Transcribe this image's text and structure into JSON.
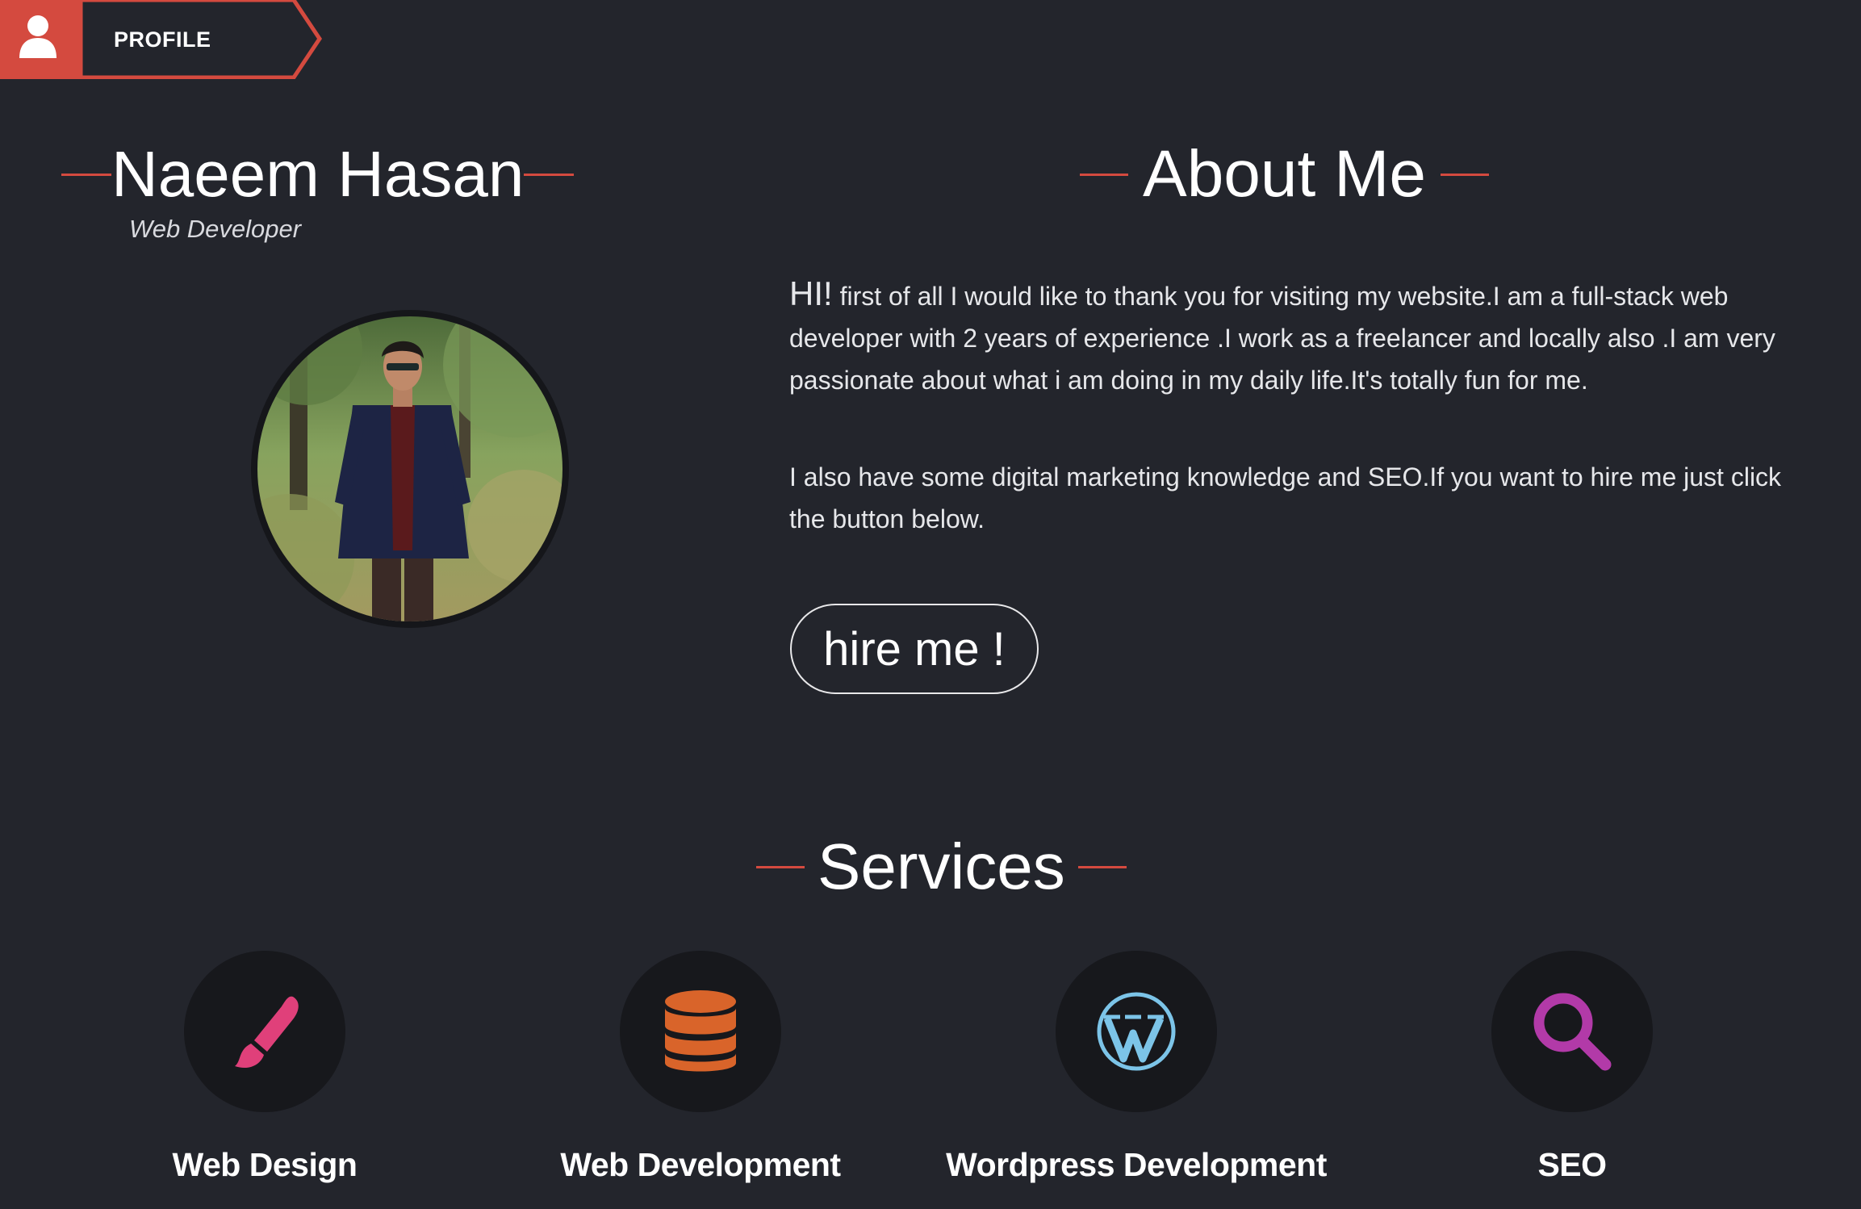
{
  "profile_tab": {
    "label": "PROFILE",
    "icon": "user-icon",
    "accent_color": "#d44a3f"
  },
  "profile": {
    "name": "Naeem Hasan",
    "title": "Web Developer",
    "avatar_alt": "profile-photo"
  },
  "about": {
    "heading": "About Me",
    "greeting": "HI!",
    "paragraph_1": "first of all I would like to thank you for visiting my website.I am a full-stack web developer with 2 years of experience .I work as a freelancer and locally also .I am very passionate about what i am doing in my daily life.It's totally fun for me.",
    "paragraph_2": "I also have some digital marketing knowledge and SEO.If you want to hire me just click the button below.",
    "button_label": "hire me !"
  },
  "services": {
    "heading": "Services",
    "items": [
      {
        "label": "Web Design",
        "icon": "paintbrush-icon",
        "color": "#e0407a"
      },
      {
        "label": "Web Development",
        "icon": "database-icon",
        "color": "#d9642a"
      },
      {
        "label": "Wordpress Development",
        "icon": "wordpress-icon",
        "color": "#7cc4e8"
      },
      {
        "label": "SEO",
        "icon": "search-icon",
        "color": "#b23aa8"
      }
    ]
  },
  "colors": {
    "background": "#23252c",
    "accent": "#d44a3f",
    "icon_circle": "#17181c"
  }
}
